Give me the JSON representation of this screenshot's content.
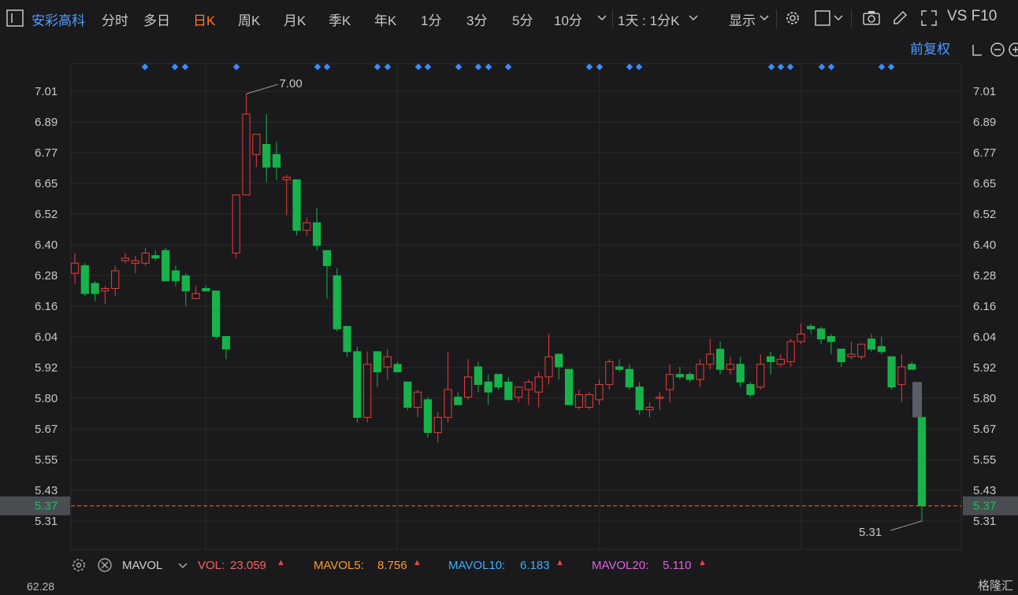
{
  "header": {
    "stock_name": "安彩高科",
    "tabs": [
      "分时",
      "多日",
      "日K",
      "周K",
      "月K",
      "季K",
      "年K",
      "1分",
      "3分",
      "5分",
      "10分"
    ],
    "active_tab": "日K",
    "period_select": "1天 : 1分K",
    "display_label": "显示",
    "right_label": "VS F10",
    "adjust_label": "前复权"
  },
  "colors": {
    "up": "#f03a3a",
    "down": "#17b34a",
    "accent": "#ff7a1a",
    "blue": "#4f9cff",
    "mavol10": "#3ab0ff",
    "mavol20": "#e060e0"
  },
  "chart_data": {
    "type": "candlestick",
    "y_ticks": [
      "7.01",
      "6.89",
      "6.77",
      "6.65",
      "6.52",
      "6.40",
      "6.28",
      "6.16",
      "6.04",
      "5.92",
      "5.80",
      "5.67",
      "5.55",
      "5.43",
      "5.31"
    ],
    "ylim": [
      5.31,
      7.01
    ],
    "high_label": "7.00",
    "low_label": "5.31",
    "current_price": "5.37",
    "candles": [
      {
        "o": 6.29,
        "h": 6.37,
        "l": 6.25,
        "c": 6.33
      },
      {
        "o": 6.32,
        "h": 6.33,
        "l": 6.2,
        "c": 6.21
      },
      {
        "o": 6.25,
        "h": 6.26,
        "l": 6.18,
        "c": 6.21
      },
      {
        "o": 6.22,
        "h": 6.24,
        "l": 6.17,
        "c": 6.23
      },
      {
        "o": 6.23,
        "h": 6.32,
        "l": 6.2,
        "c": 6.3
      },
      {
        "o": 6.34,
        "h": 6.37,
        "l": 6.33,
        "c": 6.35
      },
      {
        "o": 6.33,
        "h": 6.36,
        "l": 6.29,
        "c": 6.34
      },
      {
        "o": 6.33,
        "h": 6.39,
        "l": 6.32,
        "c": 6.37
      },
      {
        "o": 6.36,
        "h": 6.38,
        "l": 6.34,
        "c": 6.35
      },
      {
        "o": 6.38,
        "h": 6.39,
        "l": 6.26,
        "c": 6.26
      },
      {
        "o": 6.3,
        "h": 6.32,
        "l": 6.24,
        "c": 6.26
      },
      {
        "o": 6.28,
        "h": 6.29,
        "l": 6.16,
        "c": 6.22
      },
      {
        "o": 6.19,
        "h": 6.24,
        "l": 6.19,
        "c": 6.21
      },
      {
        "o": 6.23,
        "h": 6.24,
        "l": 6.22,
        "c": 6.22
      },
      {
        "o": 6.22,
        "h": 6.22,
        "l": 6.03,
        "c": 6.04
      },
      {
        "o": 6.04,
        "h": 6.04,
        "l": 5.95,
        "c": 5.99
      },
      {
        "o": 6.37,
        "h": 6.6,
        "l": 6.35,
        "c": 6.6
      },
      {
        "o": 6.6,
        "h": 7.0,
        "l": 6.6,
        "c": 6.92
      },
      {
        "o": 6.76,
        "h": 6.84,
        "l": 6.71,
        "c": 6.84
      },
      {
        "o": 6.8,
        "h": 6.92,
        "l": 6.65,
        "c": 6.71
      },
      {
        "o": 6.76,
        "h": 6.81,
        "l": 6.66,
        "c": 6.71
      },
      {
        "o": 6.66,
        "h": 6.68,
        "l": 6.52,
        "c": 6.67
      },
      {
        "o": 6.66,
        "h": 6.66,
        "l": 6.44,
        "c": 6.46
      },
      {
        "o": 6.46,
        "h": 6.51,
        "l": 6.44,
        "c": 6.49
      },
      {
        "o": 6.49,
        "h": 6.55,
        "l": 6.38,
        "c": 6.4
      },
      {
        "o": 6.38,
        "h": 6.38,
        "l": 6.19,
        "c": 6.32
      },
      {
        "o": 6.28,
        "h": 6.31,
        "l": 6.06,
        "c": 6.07
      },
      {
        "o": 6.08,
        "h": 6.08,
        "l": 5.96,
        "c": 5.98
      },
      {
        "o": 5.98,
        "h": 6.0,
        "l": 5.7,
        "c": 5.72
      },
      {
        "o": 5.72,
        "h": 5.98,
        "l": 5.7,
        "c": 5.93
      },
      {
        "o": 5.98,
        "h": 5.98,
        "l": 5.84,
        "c": 5.9
      },
      {
        "o": 5.92,
        "h": 5.99,
        "l": 5.87,
        "c": 5.96
      },
      {
        "o": 5.93,
        "h": 5.94,
        "l": 5.9,
        "c": 5.9
      },
      {
        "o": 5.86,
        "h": 5.86,
        "l": 5.75,
        "c": 5.76
      },
      {
        "o": 5.76,
        "h": 5.83,
        "l": 5.72,
        "c": 5.82
      },
      {
        "o": 5.79,
        "h": 5.8,
        "l": 5.64,
        "c": 5.66
      },
      {
        "o": 5.66,
        "h": 5.74,
        "l": 5.62,
        "c": 5.72
      },
      {
        "o": 5.72,
        "h": 5.98,
        "l": 5.7,
        "c": 5.83
      },
      {
        "o": 5.8,
        "h": 5.82,
        "l": 5.77,
        "c": 5.77
      },
      {
        "o": 5.8,
        "h": 5.95,
        "l": 5.79,
        "c": 5.88
      },
      {
        "o": 5.92,
        "h": 5.94,
        "l": 5.82,
        "c": 5.85
      },
      {
        "o": 5.86,
        "h": 5.89,
        "l": 5.77,
        "c": 5.82
      },
      {
        "o": 5.89,
        "h": 5.89,
        "l": 5.83,
        "c": 5.84
      },
      {
        "o": 5.86,
        "h": 5.88,
        "l": 5.8,
        "c": 5.79
      },
      {
        "o": 5.8,
        "h": 5.84,
        "l": 5.78,
        "c": 5.84
      },
      {
        "o": 5.83,
        "h": 5.87,
        "l": 5.77,
        "c": 5.86
      },
      {
        "o": 5.82,
        "h": 5.9,
        "l": 5.76,
        "c": 5.88
      },
      {
        "o": 5.88,
        "h": 6.05,
        "l": 5.85,
        "c": 5.96
      },
      {
        "o": 5.97,
        "h": 5.97,
        "l": 5.87,
        "c": 5.92
      },
      {
        "o": 5.91,
        "h": 5.91,
        "l": 5.77,
        "c": 5.77
      },
      {
        "o": 5.76,
        "h": 5.83,
        "l": 5.75,
        "c": 5.81
      },
      {
        "o": 5.76,
        "h": 5.82,
        "l": 5.75,
        "c": 5.81
      },
      {
        "o": 5.79,
        "h": 5.87,
        "l": 5.77,
        "c": 5.85
      },
      {
        "o": 5.85,
        "h": 5.95,
        "l": 5.83,
        "c": 5.94
      },
      {
        "o": 5.92,
        "h": 5.95,
        "l": 5.9,
        "c": 5.91
      },
      {
        "o": 5.91,
        "h": 5.93,
        "l": 5.83,
        "c": 5.84
      },
      {
        "o": 5.84,
        "h": 5.86,
        "l": 5.73,
        "c": 5.75
      },
      {
        "o": 5.75,
        "h": 5.78,
        "l": 5.72,
        "c": 5.76
      },
      {
        "o": 5.8,
        "h": 5.82,
        "l": 5.75,
        "c": 5.8
      },
      {
        "o": 5.83,
        "h": 5.93,
        "l": 5.78,
        "c": 5.89
      },
      {
        "o": 5.89,
        "h": 5.92,
        "l": 5.87,
        "c": 5.88
      },
      {
        "o": 5.89,
        "h": 5.9,
        "l": 5.86,
        "c": 5.87
      },
      {
        "o": 5.87,
        "h": 5.95,
        "l": 5.84,
        "c": 5.93
      },
      {
        "o": 5.93,
        "h": 6.03,
        "l": 5.91,
        "c": 5.97
      },
      {
        "o": 5.99,
        "h": 6.02,
        "l": 5.89,
        "c": 5.91
      },
      {
        "o": 5.91,
        "h": 5.96,
        "l": 5.89,
        "c": 5.93
      },
      {
        "o": 5.93,
        "h": 5.96,
        "l": 5.84,
        "c": 5.86
      },
      {
        "o": 5.85,
        "h": 5.86,
        "l": 5.8,
        "c": 5.81
      },
      {
        "o": 5.84,
        "h": 5.97,
        "l": 5.83,
        "c": 5.93
      },
      {
        "o": 5.96,
        "h": 5.98,
        "l": 5.89,
        "c": 5.94
      },
      {
        "o": 5.93,
        "h": 5.97,
        "l": 5.92,
        "c": 5.95
      },
      {
        "o": 5.94,
        "h": 6.03,
        "l": 5.92,
        "c": 6.02
      },
      {
        "o": 6.02,
        "h": 6.09,
        "l": 6.01,
        "c": 6.05
      },
      {
        "o": 6.08,
        "h": 6.09,
        "l": 6.05,
        "c": 6.07
      },
      {
        "o": 6.07,
        "h": 6.08,
        "l": 6.01,
        "c": 6.03
      },
      {
        "o": 6.04,
        "h": 6.05,
        "l": 5.97,
        "c": 6.02
      },
      {
        "o": 5.99,
        "h": 5.99,
        "l": 5.92,
        "c": 5.94
      },
      {
        "o": 5.96,
        "h": 6.02,
        "l": 5.95,
        "c": 5.97
      },
      {
        "o": 5.96,
        "h": 6.01,
        "l": 5.95,
        "c": 6.01
      },
      {
        "o": 6.03,
        "h": 6.05,
        "l": 5.98,
        "c": 5.99
      },
      {
        "o": 6.0,
        "h": 6.04,
        "l": 5.97,
        "c": 5.98
      },
      {
        "o": 5.96,
        "h": 5.96,
        "l": 5.83,
        "c": 5.84
      },
      {
        "o": 5.85,
        "h": 5.97,
        "l": 5.78,
        "c": 5.92
      },
      {
        "o": 5.93,
        "h": 5.94,
        "l": 5.91,
        "c": 5.91
      },
      {
        "o": 5.72,
        "h": 5.72,
        "l": 5.31,
        "c": 5.37
      }
    ]
  },
  "volume": {
    "indicator": "MAVOL",
    "vol_label": "VOL:",
    "vol_value": "23.059",
    "mavol5_label": "MAVOL5:",
    "mavol5_value": "8.756",
    "mavol10_label": "MAVOL10:",
    "mavol10_value": "6.183",
    "mavol20_label": "MAVOL20:",
    "mavol20_value": "5.110",
    "axis_value": "62.28"
  },
  "brand": "格隆汇"
}
